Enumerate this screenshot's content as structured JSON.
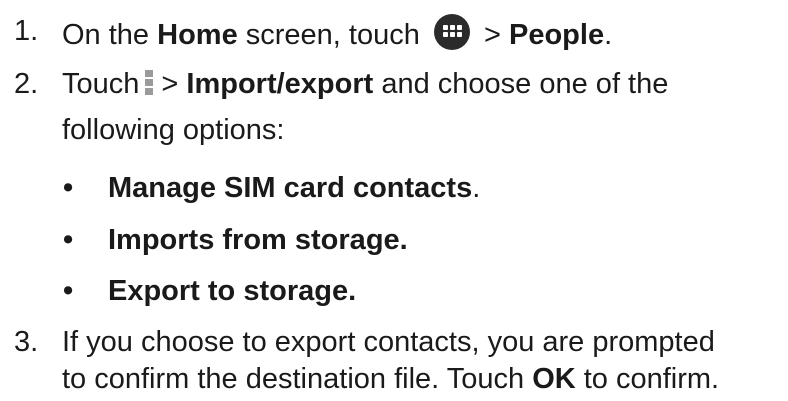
{
  "steps": [
    {
      "number": "1.",
      "parts": {
        "a": "On the ",
        "b": "Home",
        "c": " screen, touch",
        "d": "> ",
        "e": "People",
        "f": "."
      },
      "icon": "apps-drawer-icon"
    },
    {
      "number": "2.",
      "parts": {
        "a": "Touch",
        "b": "> ",
        "c": "Import/export",
        "d": " and choose one of the",
        "e": "following options:"
      },
      "icon": "menu-icon"
    },
    {
      "number": "3.",
      "parts": {
        "a": "If you choose to export contacts, you are prompted",
        "b": "to confirm the destination file. Touch ",
        "c": "OK",
        "d": " to confirm."
      }
    }
  ],
  "options": {
    "bullet": "•",
    "items": [
      {
        "label": "Manage SIM card contacts",
        "suffix": "."
      },
      {
        "label": "Imports from storage.",
        "suffix": ""
      },
      {
        "label": "Export to storage.",
        "suffix": ""
      }
    ]
  }
}
